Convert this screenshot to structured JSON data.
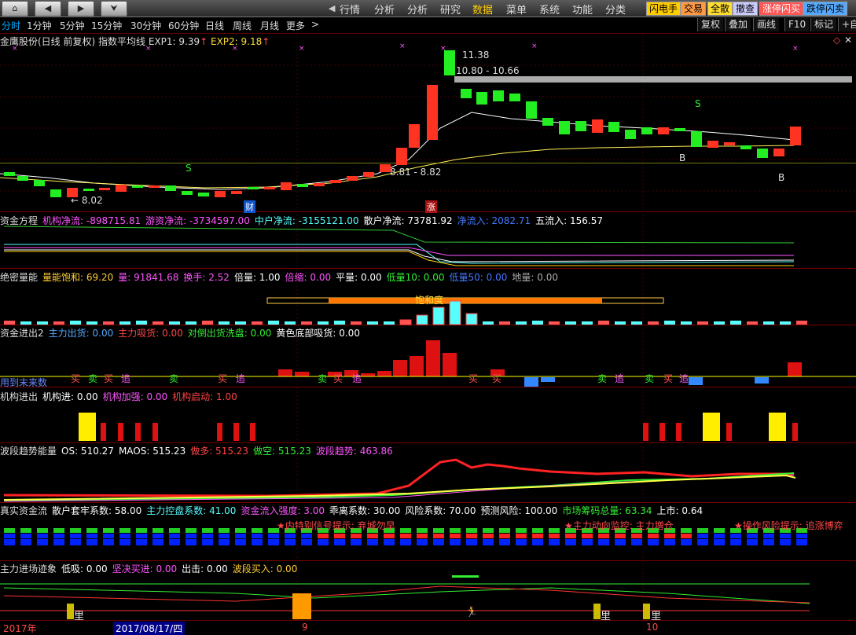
{
  "topbar": {
    "nav_icons": [
      "home-icon",
      "arrow-left-icon",
      "arrow-right-icon",
      "double-chevron-down-icon"
    ],
    "menu": [
      "行情",
      "分析",
      "分析",
      "研究",
      "数据",
      "菜单",
      "系统",
      "功能",
      "分类"
    ],
    "active_menu": "数据",
    "right_buttons": [
      "闪电手",
      "交易",
      "全散",
      "撤查",
      "涨停闪买",
      "跌停闪卖"
    ]
  },
  "periodbar": {
    "periods": [
      "分时",
      "1分钟",
      "5分钟",
      "15分钟",
      "30分钟",
      "60分钟",
      "日线",
      "周线",
      "月线",
      "更多"
    ],
    "active": "分时",
    "more_arrow": ">",
    "tools": [
      "复权",
      "叠加",
      "画线",
      "F10",
      "标记",
      "+自"
    ]
  },
  "main_panel": {
    "stock_name": "金鹰股份(日线 前复权)",
    "indicator": "指数平均线",
    "exp1_label": "EXP1: 9.39",
    "exp2_label": "EXP2: 9.18",
    "high_label": "11.38",
    "range_label": "10.80 - 10.66",
    "low_label": "8.02",
    "mid_label": "8.81 - 8.82",
    "s_marker": "S",
    "b_marker": "B",
    "cai_badge": "财",
    "zhang_badge": "涨"
  },
  "panel_fund": {
    "title": "资金方程",
    "items": [
      "机构净流: -898715.81",
      "游资净流: -3734597.00",
      "中户净流: -3155121.00",
      "散户净流: 73781.92",
      "净流入: 2082.71",
      "五流入: 156.57"
    ]
  },
  "panel_volume": {
    "title": "绝密量能",
    "items": [
      "量能饱和: 69.20",
      "量: 91841.68",
      "换手: 2.52",
      "倍量: 1.00",
      "倍缩: 0.00",
      "平量: 0.00",
      "低量10: 0.00",
      "低量50: 0.00",
      "地量: 0.00"
    ],
    "saturation_label": "饱和度"
  },
  "panel_inout": {
    "title": "资金进出2",
    "items": [
      "主力出货: 0.00",
      "主力吸货: 0.00",
      "对倒出货洗盘: 0.00",
      "黄色底部吸货: 0.00"
    ],
    "overlay_label": "用到末来数",
    "buy_labels": [
      "买",
      "卖",
      "买",
      "追",
      "卖",
      "买",
      "追",
      "卖",
      "买",
      "追",
      "买",
      "买",
      "卖",
      "追",
      "卖",
      "买",
      "追"
    ]
  },
  "panel_inst": {
    "title": "机构进出",
    "items": [
      "机构进: 0.00",
      "机构加强: 0.00",
      "机构启动: 1.00"
    ]
  },
  "panel_wave": {
    "title": "波段趋势能量",
    "items": [
      "OS: 510.27",
      "MAOS: 515.23",
      "做多: 515.23",
      "做空: 515.23",
      "波段趋势: 463.86"
    ]
  },
  "panel_real": {
    "title": "真实资金流",
    "items": [
      "散户套牢系数: 58.00",
      "主力控盘系数: 41.00",
      "资金流入强度: 3.00",
      "乖离系数: 30.00",
      "风险系数: 70.00",
      "预测风险: 100.00",
      "市场筹码总量: 63.34",
      "上市: 0.64"
    ],
    "alerts": [
      "★内特别信号提示: 弃城勿早",
      "★主力动向监控: 主力増仓",
      "★操作风险提示: 追涨博弈"
    ]
  },
  "panel_main": {
    "title": "主力进场迹象",
    "items": [
      "低吸: 0.00",
      "坚决买进: 0.00",
      "出击: 0.00",
      "波段买入: 0.00"
    ],
    "li_label": "里"
  },
  "timebar": {
    "year": "2017年",
    "date": "2017/08/17/四",
    "month9": "9",
    "month10": "10"
  },
  "colors": {
    "up": "#ff3322",
    "down": "#22ee22",
    "border": "#7a0000",
    "cyan": "#55ffff",
    "yellow": "#ffee00"
  }
}
